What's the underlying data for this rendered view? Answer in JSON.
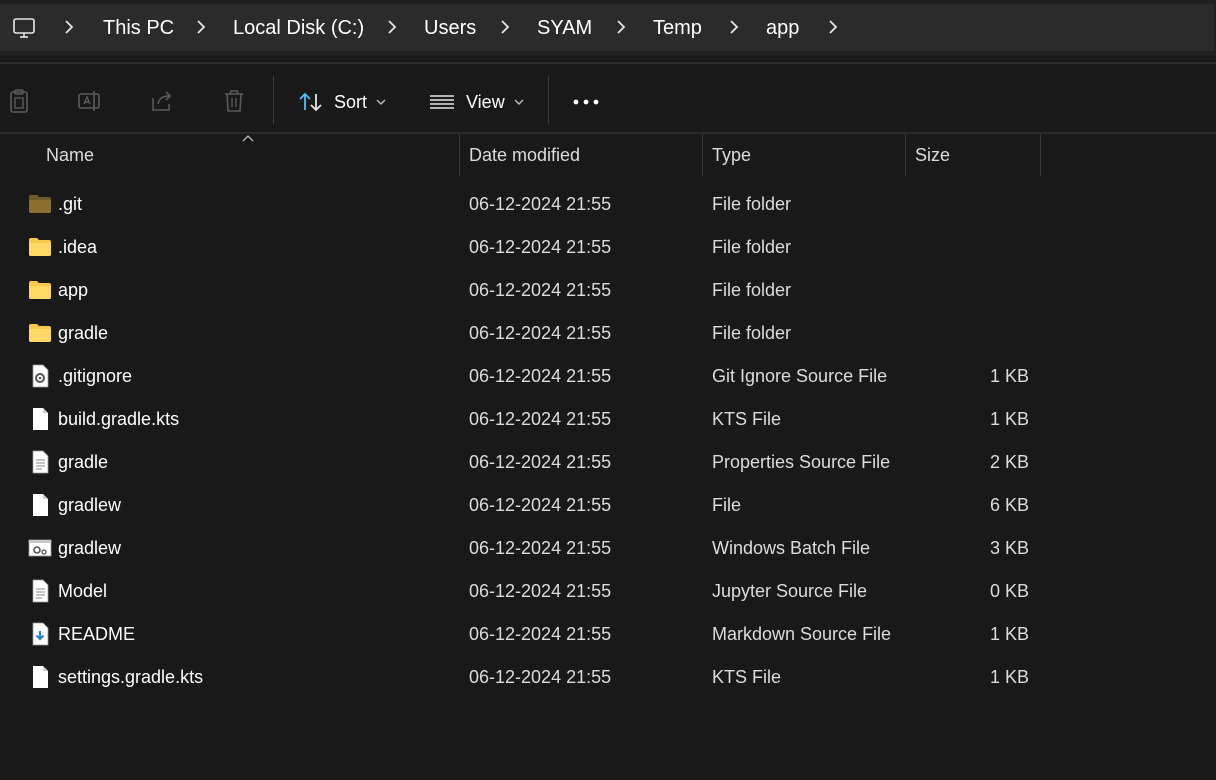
{
  "breadcrumb": {
    "items": [
      "This PC",
      "Local Disk (C:)",
      "Users",
      "SYAM",
      "Temp",
      "app"
    ]
  },
  "toolbar": {
    "sort_label": "Sort",
    "view_label": "View",
    "icons": [
      "copy-icon",
      "rename-icon",
      "share-icon",
      "delete-icon",
      "sort-icon",
      "view-icon",
      "more-icon"
    ]
  },
  "columns": {
    "name": "Name",
    "date": "Date modified",
    "type": "Type",
    "size": "Size"
  },
  "files": [
    {
      "name": ".git",
      "date": "06-12-2024 21:55",
      "type": "File folder",
      "size": "",
      "icon": "folder-icon-dim"
    },
    {
      "name": ".idea",
      "date": "06-12-2024 21:55",
      "type": "File folder",
      "size": "",
      "icon": "folder-icon"
    },
    {
      "name": "app",
      "date": "06-12-2024 21:55",
      "type": "File folder",
      "size": "",
      "icon": "folder-icon"
    },
    {
      "name": "gradle",
      "date": "06-12-2024 21:55",
      "type": "File folder",
      "size": "",
      "icon": "folder-icon"
    },
    {
      "name": ".gitignore",
      "date": "06-12-2024 21:55",
      "type": "Git Ignore Source File",
      "size": "1 KB",
      "icon": "gear-file-icon"
    },
    {
      "name": "build.gradle.kts",
      "date": "06-12-2024 21:55",
      "type": "KTS File",
      "size": "1 KB",
      "icon": "blank-file-icon"
    },
    {
      "name": "gradle",
      "date": "06-12-2024 21:55",
      "type": "Properties Source File",
      "size": "2 KB",
      "icon": "text-file-icon"
    },
    {
      "name": "gradlew",
      "date": "06-12-2024 21:55",
      "type": "File",
      "size": "6 KB",
      "icon": "blank-file-icon"
    },
    {
      "name": "gradlew",
      "date": "06-12-2024 21:55",
      "type": "Windows Batch File",
      "size": "3 KB",
      "icon": "batch-file-icon"
    },
    {
      "name": "Model",
      "date": "06-12-2024 21:55",
      "type": "Jupyter Source File",
      "size": "0 KB",
      "icon": "text-file-icon"
    },
    {
      "name": "README",
      "date": "06-12-2024 21:55",
      "type": "Markdown Source File",
      "size": "1 KB",
      "icon": "markdown-file-icon"
    },
    {
      "name": "settings.gradle.kts",
      "date": "06-12-2024 21:55",
      "type": "KTS File",
      "size": "1 KB",
      "icon": "blank-file-icon"
    }
  ],
  "colors": {
    "background": "#191919",
    "address_bar": "#2b2b2b",
    "folder": "#f7c94a",
    "folder_dim": "#8a6f2e",
    "accent": "#4cc2ff"
  }
}
